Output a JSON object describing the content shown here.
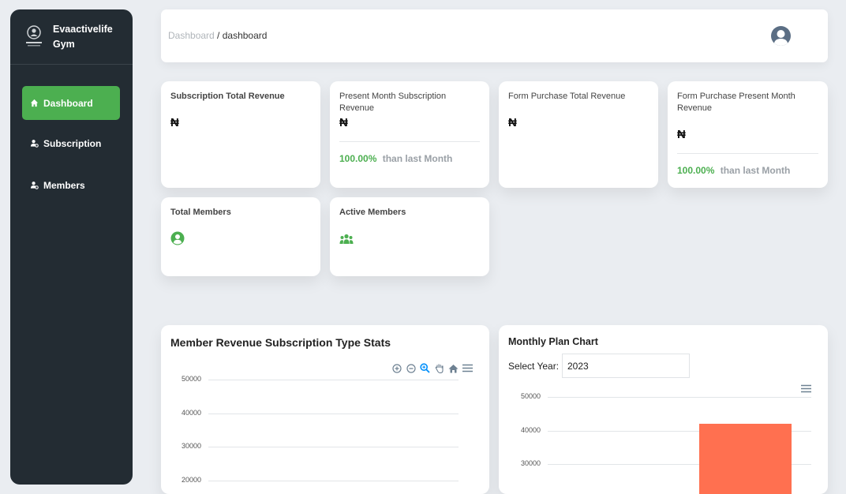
{
  "sidebar": {
    "brand": {
      "title": "Evaactivelife Gym"
    },
    "items": [
      {
        "label": "Dashboard",
        "icon": "home-icon",
        "active": true
      },
      {
        "label": "Subscription",
        "icon": "user-cog-icon",
        "active": false
      },
      {
        "label": "Members",
        "icon": "user-cog-icon",
        "active": false
      }
    ]
  },
  "header": {
    "breadcrumb": {
      "parent": "Dashboard",
      "separator": " / ",
      "current": "dashboard"
    },
    "avatar_icon": "user-avatar-icon"
  },
  "cards": [
    {
      "title": "Subscription Total Revenue",
      "currency": "₦"
    },
    {
      "title": "Present Month Subscription Revenue",
      "currency": "₦",
      "delta_pct": "100.00%",
      "delta_text": "than last Month"
    },
    {
      "title": "Form Purchase Total Revenue",
      "currency": "₦"
    },
    {
      "title": "Form Purchase Present Month Revenue",
      "currency": "₦",
      "delta_pct": "100.00%",
      "delta_text": "than last Month"
    },
    {
      "title": "Total Members",
      "icon": "user-circle-icon"
    },
    {
      "title": "Active Members",
      "icon": "users-group-icon"
    }
  ],
  "colors": {
    "accent": "#4caf50",
    "sidebar": "#232c33",
    "bar": "#ff7050"
  },
  "chart_data": [
    {
      "type": "line",
      "title": "Member Revenue Subscription Type Stats",
      "y_ticks": [
        "50000",
        "40000",
        "30000",
        "20000"
      ],
      "toolbar": [
        "zoom-in-icon",
        "zoom-out-icon",
        "zoom-select-icon",
        "pan-hand-icon",
        "reset-home-icon",
        "menu-icon"
      ]
    },
    {
      "type": "bar",
      "title": "Monthly Plan Chart",
      "select_label": "Select Year:",
      "select_value": "2023",
      "y_ticks": [
        "50000",
        "40000",
        "30000"
      ],
      "toolbar": [
        "menu-icon"
      ],
      "values": [
        42000
      ]
    }
  ]
}
